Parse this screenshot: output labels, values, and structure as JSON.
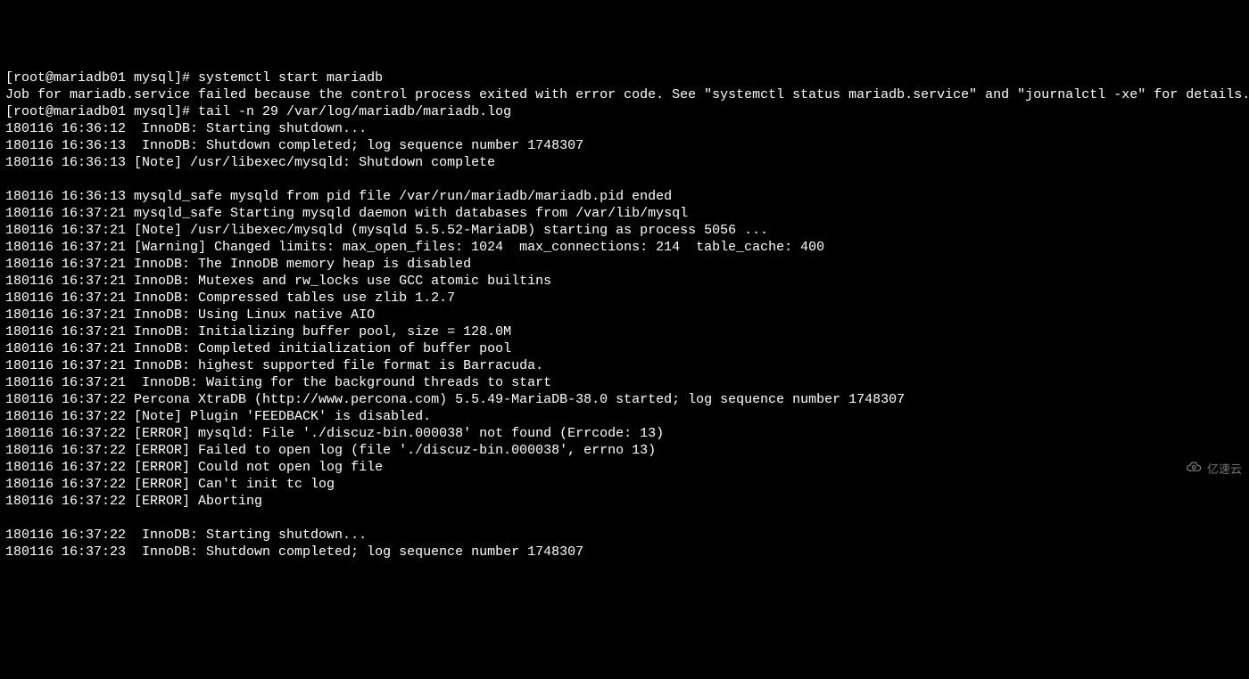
{
  "terminal": {
    "lines": [
      "[root@mariadb01 mysql]# systemctl start mariadb",
      "Job for mariadb.service failed because the control process exited with error code. See \"systemctl status mariadb.service\" and \"journalctl -xe\" for details.",
      "[root@mariadb01 mysql]# tail -n 29 /var/log/mariadb/mariadb.log",
      "180116 16:36:12  InnoDB: Starting shutdown...",
      "180116 16:36:13  InnoDB: Shutdown completed; log sequence number 1748307",
      "180116 16:36:13 [Note] /usr/libexec/mysqld: Shutdown complete",
      "",
      "180116 16:36:13 mysqld_safe mysqld from pid file /var/run/mariadb/mariadb.pid ended",
      "180116 16:37:21 mysqld_safe Starting mysqld daemon with databases from /var/lib/mysql",
      "180116 16:37:21 [Note] /usr/libexec/mysqld (mysqld 5.5.52-MariaDB) starting as process 5056 ...",
      "180116 16:37:21 [Warning] Changed limits: max_open_files: 1024  max_connections: 214  table_cache: 400",
      "180116 16:37:21 InnoDB: The InnoDB memory heap is disabled",
      "180116 16:37:21 InnoDB: Mutexes and rw_locks use GCC atomic builtins",
      "180116 16:37:21 InnoDB: Compressed tables use zlib 1.2.7",
      "180116 16:37:21 InnoDB: Using Linux native AIO",
      "180116 16:37:21 InnoDB: Initializing buffer pool, size = 128.0M",
      "180116 16:37:21 InnoDB: Completed initialization of buffer pool",
      "180116 16:37:21 InnoDB: highest supported file format is Barracuda.",
      "180116 16:37:21  InnoDB: Waiting for the background threads to start",
      "180116 16:37:22 Percona XtraDB (http://www.percona.com) 5.5.49-MariaDB-38.0 started; log sequence number 1748307",
      "180116 16:37:22 [Note] Plugin 'FEEDBACK' is disabled.",
      "180116 16:37:22 [ERROR] mysqld: File './discuz-bin.000038' not found (Errcode: 13)",
      "180116 16:37:22 [ERROR] Failed to open log (file './discuz-bin.000038', errno 13)",
      "180116 16:37:22 [ERROR] Could not open log file",
      "180116 16:37:22 [ERROR] Can't init tc log",
      "180116 16:37:22 [ERROR] Aborting",
      "",
      "180116 16:37:22  InnoDB: Starting shutdown...",
      "180116 16:37:23  InnoDB: Shutdown completed; log sequence number 1748307"
    ]
  },
  "watermark": {
    "text": "亿速云"
  }
}
